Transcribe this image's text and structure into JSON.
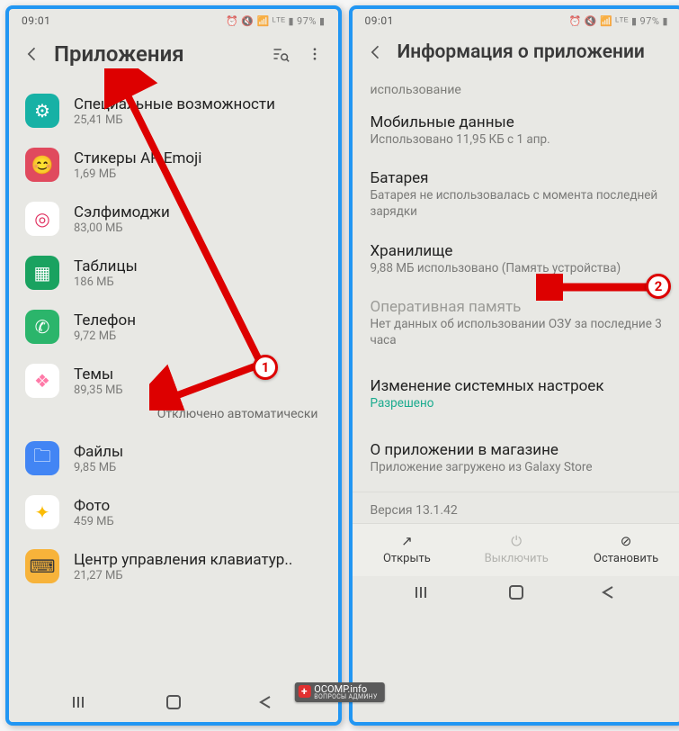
{
  "statusbar": {
    "time": "09:01",
    "battery": "97%"
  },
  "left": {
    "title": "Приложения",
    "apps": [
      {
        "name": "Специальные возможности",
        "sub": "25,41 МБ",
        "iconBg": "#17b1a5",
        "iconGlyph": "⚙"
      },
      {
        "name": "Стикеры AR Emoji",
        "sub": "1,69 МБ",
        "iconBg": "#e04a5e",
        "iconGlyph": "😊"
      },
      {
        "name": "Сэлфимоджи",
        "sub": "83,00 МБ",
        "iconBg": "#ffffff",
        "iconGlyph": "◎",
        "iconFg": "#e03060"
      },
      {
        "name": "Таблицы",
        "sub": "186 МБ",
        "iconBg": "#1aa260",
        "iconGlyph": "▦"
      },
      {
        "name": "Телефон",
        "sub": "9,72 МБ",
        "iconBg": "#2bb56b",
        "iconGlyph": "✆"
      },
      {
        "name": "Темы",
        "sub": "89,35 МБ",
        "iconBg": "#ffffff",
        "iconGlyph": "❖",
        "iconFg": "#ff7aa8"
      },
      {
        "name": "Файлы",
        "sub": "9,85 МБ",
        "iconBg": "#4285f4",
        "iconGlyph": "🗀"
      },
      {
        "name": "Фото",
        "sub": "459 МБ",
        "iconBg": "#ffffff",
        "iconGlyph": "✦",
        "iconFg": "#fbbc05"
      },
      {
        "name": "Центр управления клавиатур..",
        "sub": "21,27 МБ",
        "iconBg": "#f7b33a",
        "iconGlyph": "⌨",
        "iconFg": "#3a3a3a"
      }
    ],
    "autoDisabled": "Отключено автоматически"
  },
  "right": {
    "title": "Информация о приложении",
    "usageLabel": "использование",
    "sections": [
      {
        "title": "Мобильные данные",
        "sub": "Использовано 11,95 КБ с 1 апр."
      },
      {
        "title": "Батарея",
        "sub": "Батарея не использовалась с момента последней зарядки"
      },
      {
        "title": "Хранилище",
        "sub": "9,88 МБ использовано (Память устройства)"
      },
      {
        "title": "Оперативная память",
        "sub": "Нет данных об использовании ОЗУ за последние 3 часа",
        "muted": true
      },
      {
        "title": "Изменение системных настроек",
        "sub": "Разрешено",
        "link": true
      },
      {
        "title": "О приложении в магазине",
        "sub": "Приложение загружено из Galaxy Store"
      }
    ],
    "version": "Версия 13.1.42",
    "actions": {
      "open": "Открыть",
      "disable": "Выключить",
      "stop": "Остановить"
    }
  },
  "annotations": {
    "badge1": "1",
    "badge2": "2"
  },
  "watermark": {
    "line1": "OCOMP.info",
    "line2": "ВОПРОСЫ АДМИНУ"
  }
}
